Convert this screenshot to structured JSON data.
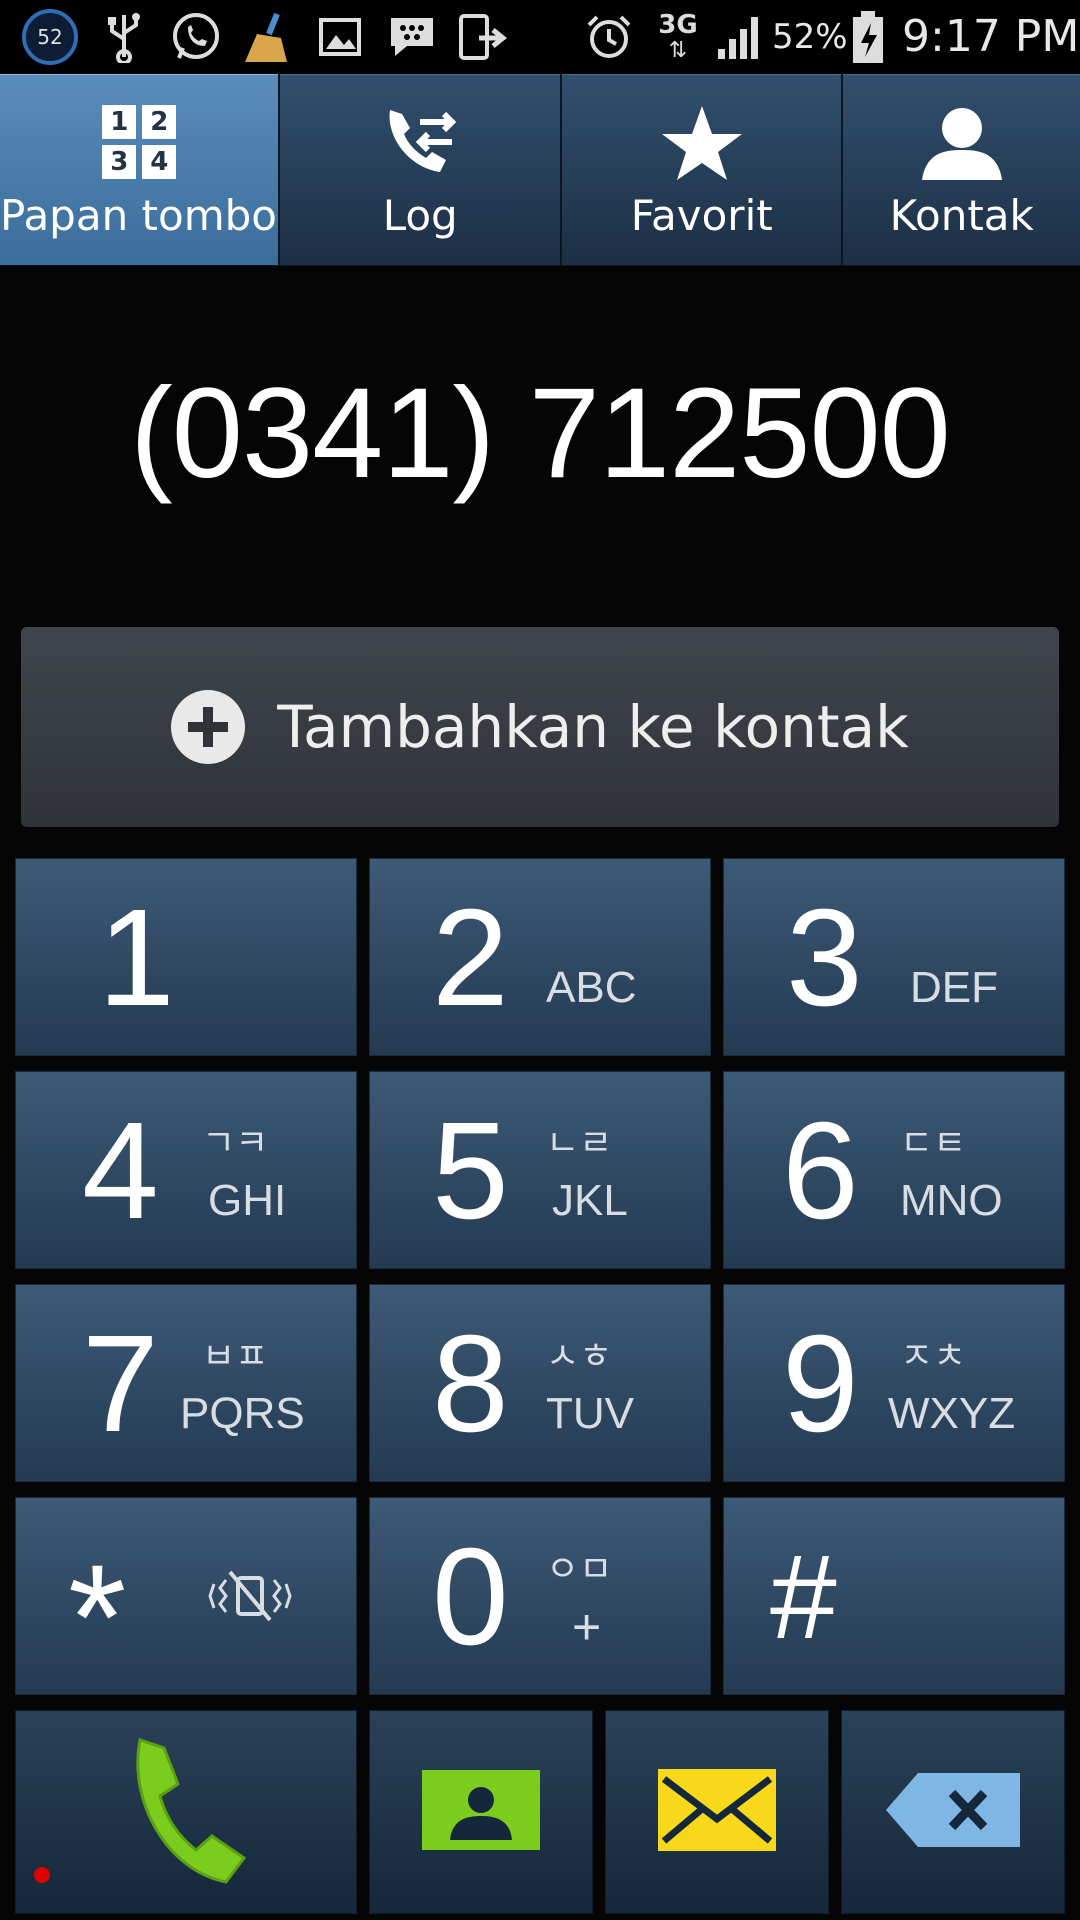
{
  "status_bar": {
    "badge_count": "52",
    "network": "3G",
    "battery": "52%",
    "time": "9:17 PM",
    "icons": [
      "badge-52-icon",
      "usb-icon",
      "whatsapp-icon",
      "cleaner-icon",
      "gallery-icon",
      "bbm-icon",
      "transfer-icon",
      "alarm-icon",
      "3g-data-icon",
      "signal-icon",
      "battery-charging-icon"
    ]
  },
  "tabs": [
    {
      "label": "Papan tombol",
      "icon": "keypad-icon",
      "active": true
    },
    {
      "label": "Log",
      "icon": "call-log-icon",
      "active": false
    },
    {
      "label": "Favorit",
      "icon": "star-icon",
      "active": false
    },
    {
      "label": "Kontak",
      "icon": "contact-person-icon",
      "active": false
    }
  ],
  "dialed_number": "(0341) 712500",
  "add_contact_label": "Tambahkan ke kontak",
  "keypad": [
    {
      "digit": "1",
      "hangul": "",
      "letters": ""
    },
    {
      "digit": "2",
      "hangul": "",
      "letters": "ABC"
    },
    {
      "digit": "3",
      "hangul": "",
      "letters": "DEF"
    },
    {
      "digit": "4",
      "hangul": "ㄱㅋ",
      "letters": "GHI"
    },
    {
      "digit": "5",
      "hangul": "ㄴㄹ",
      "letters": "JKL"
    },
    {
      "digit": "6",
      "hangul": "ㄷㅌ",
      "letters": "MNO"
    },
    {
      "digit": "7",
      "hangul": "ㅂㅍ",
      "letters": "PQRS"
    },
    {
      "digit": "8",
      "hangul": "ㅅㅎ",
      "letters": "TUV"
    },
    {
      "digit": "9",
      "hangul": "ㅈㅊ",
      "letters": "WXYZ"
    },
    {
      "digit": "*",
      "hangul": "",
      "letters": ""
    },
    {
      "digit": "0",
      "hangul": "ㅇㅁ",
      "letters": "+"
    },
    {
      "digit": "#",
      "hangul": "",
      "letters": ""
    }
  ],
  "actions": {
    "call": "phone-call-icon",
    "video": "contact-card-icon",
    "message": "envelope-icon",
    "backspace": "backspace-icon"
  },
  "colors": {
    "call_green": "#7ccc1e",
    "video_green": "#7ccc1e",
    "message_yellow": "#f8d81a",
    "backspace_blue": "#7fb6e4",
    "active_tab": "#4a7fae",
    "key_bg": "#2f4a66",
    "missed_dot": "#e00000"
  }
}
